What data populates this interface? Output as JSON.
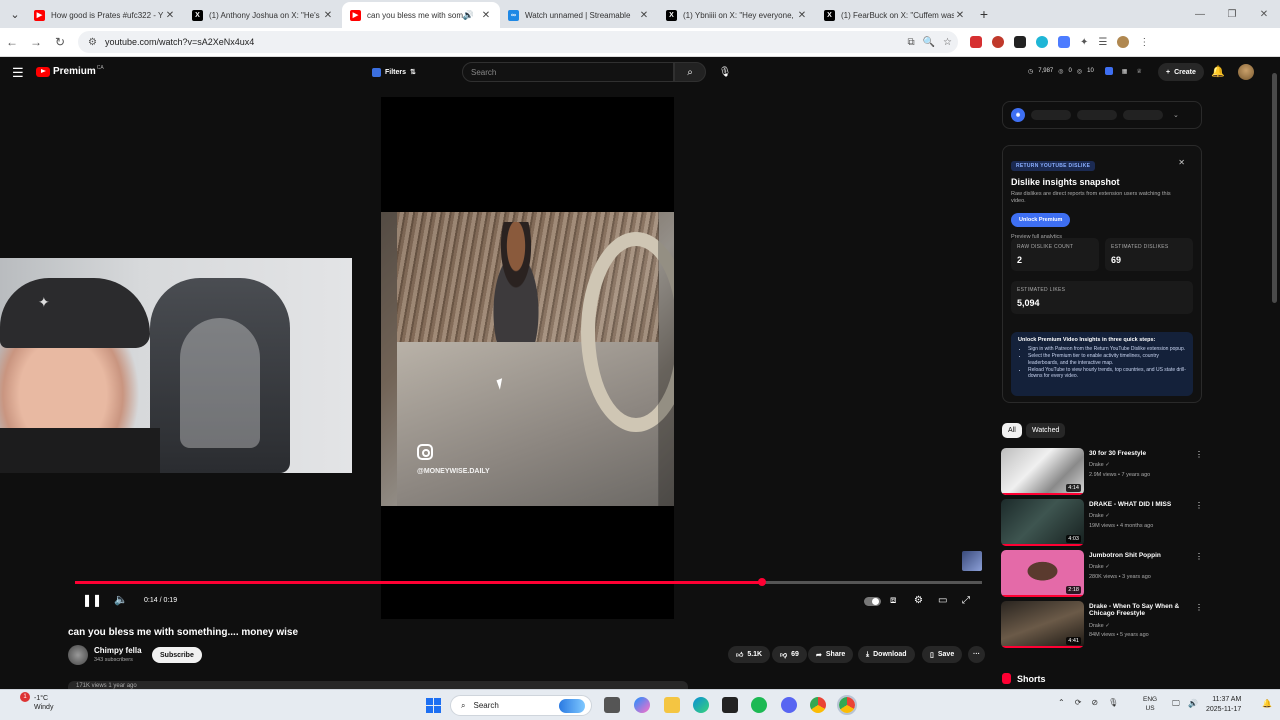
{
  "browser": {
    "tabs": [
      {
        "title": "How good is Prates #ufc322 - Y",
        "favicon_color": "#ff0000"
      },
      {
        "title": "(1) Anthony Joshua on X: \"He's",
        "favicon_color": "#000000"
      },
      {
        "title": "can you bless me with som",
        "favicon_color": "#ff0000",
        "active": true
      },
      {
        "title": "Watch unnamed | Streamable",
        "favicon_color": "#1e88e5"
      },
      {
        "title": "(1) Ybniiii on X: \"Hey everyone,",
        "favicon_color": "#000000"
      },
      {
        "title": "(1) FearBuck on X: \"Cuffem was",
        "favicon_color": "#000000"
      }
    ],
    "url": "youtube.com/watch?v=sA2XeNx4ux4"
  },
  "youtube": {
    "logo_text": "Premium",
    "logo_region": "CA",
    "filters_label": "Filters",
    "search_placeholder": "Search",
    "header_stats": [
      "7,987",
      "0",
      "10"
    ],
    "create_label": "Create",
    "video": {
      "watermark": "@MONEYWISE.DAILY",
      "time": "0:14 / 0:19",
      "progress": 0.757,
      "title": "can you bless me with something.... money wise",
      "channel": "Chimpy fella",
      "subscribers": "343 subscribers",
      "subscribe_label": "Subscribe",
      "likes": "5.1K",
      "dislikes": "69",
      "share_label": "Share",
      "download_label": "Download",
      "save_label": "Save",
      "description_peek": "171K views  1 year ago"
    },
    "ryd_panel": {
      "tag": "RETURN YOUTUBE DISLIKE",
      "heading": "Dislike insights snapshot",
      "subtext": "Raw dislikes are direct reports from extension users watching this video.",
      "unlock_label": "Unlock Premium",
      "preview_label": "Preview full analytics",
      "raw_dislike_label": "RAW DISLIKE COUNT",
      "raw_dislike_value": "2",
      "est_dislike_label": "ESTIMATED DISLIKES",
      "est_dislike_value": "69",
      "est_likes_label": "ESTIMATED LIKES",
      "est_likes_value": "5,094",
      "steps_title": "Unlock Premium Video Insights in three quick steps:",
      "steps": [
        "Sign in with Patreon from the Return YouTube Dislike extension popup.",
        "Select the Premium tier to enable activity timelines, country leaderboards, and the interactive map.",
        "Reload YouTube to view hourly trends, top countries, and US state drill-downs for every video."
      ]
    },
    "chips": {
      "all": "All",
      "watched": "Watched"
    },
    "recommendations": [
      {
        "title": "30 for 30 Freestyle",
        "channel": "Drake",
        "meta": "2.9M views • 7 years ago",
        "duration": "4:14"
      },
      {
        "title": "DRAKE - WHAT DID I MISS",
        "channel": "Drake",
        "meta": "19M views • 4 months ago",
        "duration": "4:03"
      },
      {
        "title": "Jumbotron Shit Poppin",
        "channel": "Drake",
        "meta": "280K views • 3 years ago",
        "duration": "2:18"
      },
      {
        "title": "Drake - When To Say When & Chicago Freestyle",
        "channel": "Drake",
        "meta": "84M views • 5 years ago",
        "duration": "4:41"
      }
    ],
    "shorts_label": "Shorts"
  },
  "taskbar": {
    "weather_temp": "-1°C",
    "weather_desc": "Windy",
    "weather_badge": "1",
    "search_label": "Search",
    "lang_top": "ENG",
    "lang_bottom": "US",
    "time": "11:37 AM",
    "date": "2025-11-17"
  }
}
